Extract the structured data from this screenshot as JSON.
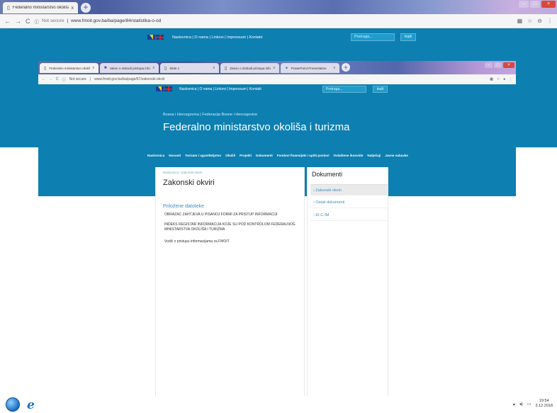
{
  "outer_browser": {
    "tab_title": "Federalno ministarstvo okoliša i",
    "tab_close": "x",
    "new_tab": "+",
    "url_security": "Not secure",
    "url": "www.fmoit.gov.ba/ba/page/84/statistika-o-od",
    "window_buttons": [
      "–",
      "□",
      "×"
    ]
  },
  "top_bar": {
    "links": "Naslovnica | O nama | Linkovi | Impressum | Kontakt",
    "search_placeholder": "Pretraga...",
    "search_button": "traži"
  },
  "inner_browser": {
    "tabs": [
      {
        "title": "Federalno ministarstvo okoliša i",
        "close": "x"
      },
      {
        "title": "zakon o slobodi pristupa inform",
        "close": "x"
      },
      {
        "title": "Slide 1",
        "close": "x"
      },
      {
        "title": "Zakon o slobodi pristupa informacijama",
        "close": "x"
      },
      {
        "title": "PowerPoint Presentation",
        "close": "x"
      }
    ],
    "new_tab": "+",
    "url_security": "Not secure",
    "url": "www.fmoit.gov.ba/ba/page/67/zakonski-okviri",
    "top_links": "Naslovnica | O nama | Linkovi | Impressum | Kontakt",
    "search_placeholder": "Pretraga...",
    "search_button": "traži"
  },
  "site": {
    "subtitle": "Bosna i Hercegovina | Federacija Bosne i Hercegovine",
    "title": "Federalno ministarstvo okoliša i turizma",
    "nav": [
      "Naslovnica",
      "Novosti",
      "Turizam i ugostiteljstvo",
      "Okoliš",
      "Projekti",
      "Dokumenti",
      "Fondovi finansijski i opšti poslovi",
      "Ovlaštene ikonvide",
      "Natječaji",
      "Javne nabavke"
    ]
  },
  "content": {
    "breadcrumb": "Naslovnica / Zakonski okviri",
    "page_title": "Zakonski okviri",
    "section": "Priložene datoteke",
    "documents": [
      "OBRAZAC ZAHTJEVA U PISANOJ FORMI ZA PRISTUP INFORMACIJI",
      "INDEKS REGISTAR INFORMACIJA KOJE SU POD KONTROLOM FEDERALNOG MINISTARSTVA OKOLIŠA I TURIZMA",
      "Vodič o pristupu informacijama za FMOIT"
    ]
  },
  "sidebar": {
    "heading": "Dokumenti",
    "items": [
      "Zakonski okviri",
      "Ostali dokumenti",
      "EI-C-IM"
    ]
  },
  "taskbar": {
    "time": "19:54",
    "date": "3.12.2018"
  }
}
